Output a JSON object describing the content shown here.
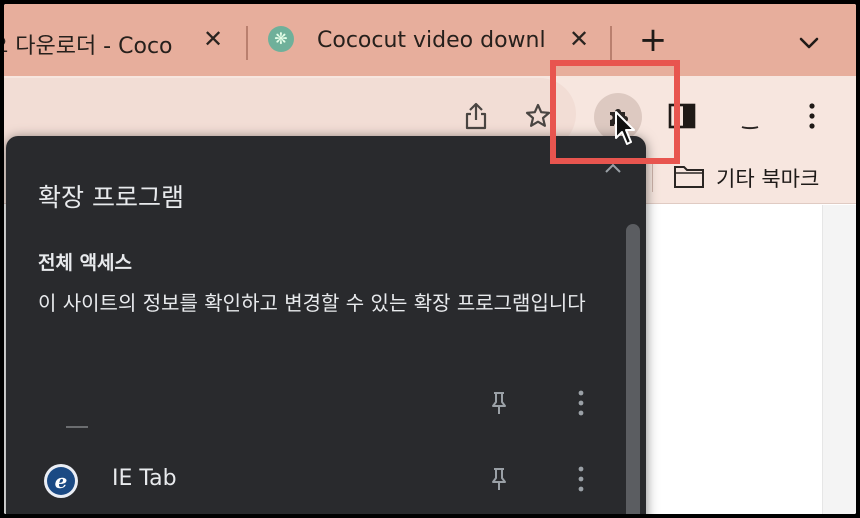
{
  "tabs": [
    {
      "title": "오 다운로더 - Coco",
      "close_label": "✕",
      "favicon": "none",
      "active": false
    },
    {
      "title": "Cococut video downl",
      "close_label": "✕",
      "favicon": "palm-tree-icon",
      "active": false
    }
  ],
  "tabstrip": {
    "new_tab_label": "+",
    "tab_search_icon": "chevron-down-icon",
    "color": "#e7ae9c"
  },
  "toolbar": {
    "icons": [
      "share-icon",
      "bookmark-star-icon",
      "extensions-puzzle-icon",
      "side-panel-icon",
      "profile-icon",
      "kebab-menu-icon"
    ],
    "highlight_color": "#e8554f"
  },
  "bookmarks": {
    "other_bookmarks_label": "기타 북마크",
    "folder_icon": "folder-icon"
  },
  "extensions_popup": {
    "title": "확장 프로그램",
    "close_icon": "close-icon",
    "section": {
      "heading": "전체 액세스",
      "description": "이 사이트의 정보를 확인하고 변경할 수 있는 확장 프로그램입니다"
    },
    "items": [
      {
        "name": "",
        "icon": "blank-extension-icon",
        "pin_icon": "pin-icon",
        "more_icon": "kebab-menu-icon"
      },
      {
        "name": "IE Tab",
        "icon": "ie-tab-icon",
        "icon_letter": "e",
        "pin_icon": "pin-icon",
        "more_icon": "kebab-menu-icon"
      }
    ],
    "background": "#292a2d"
  }
}
